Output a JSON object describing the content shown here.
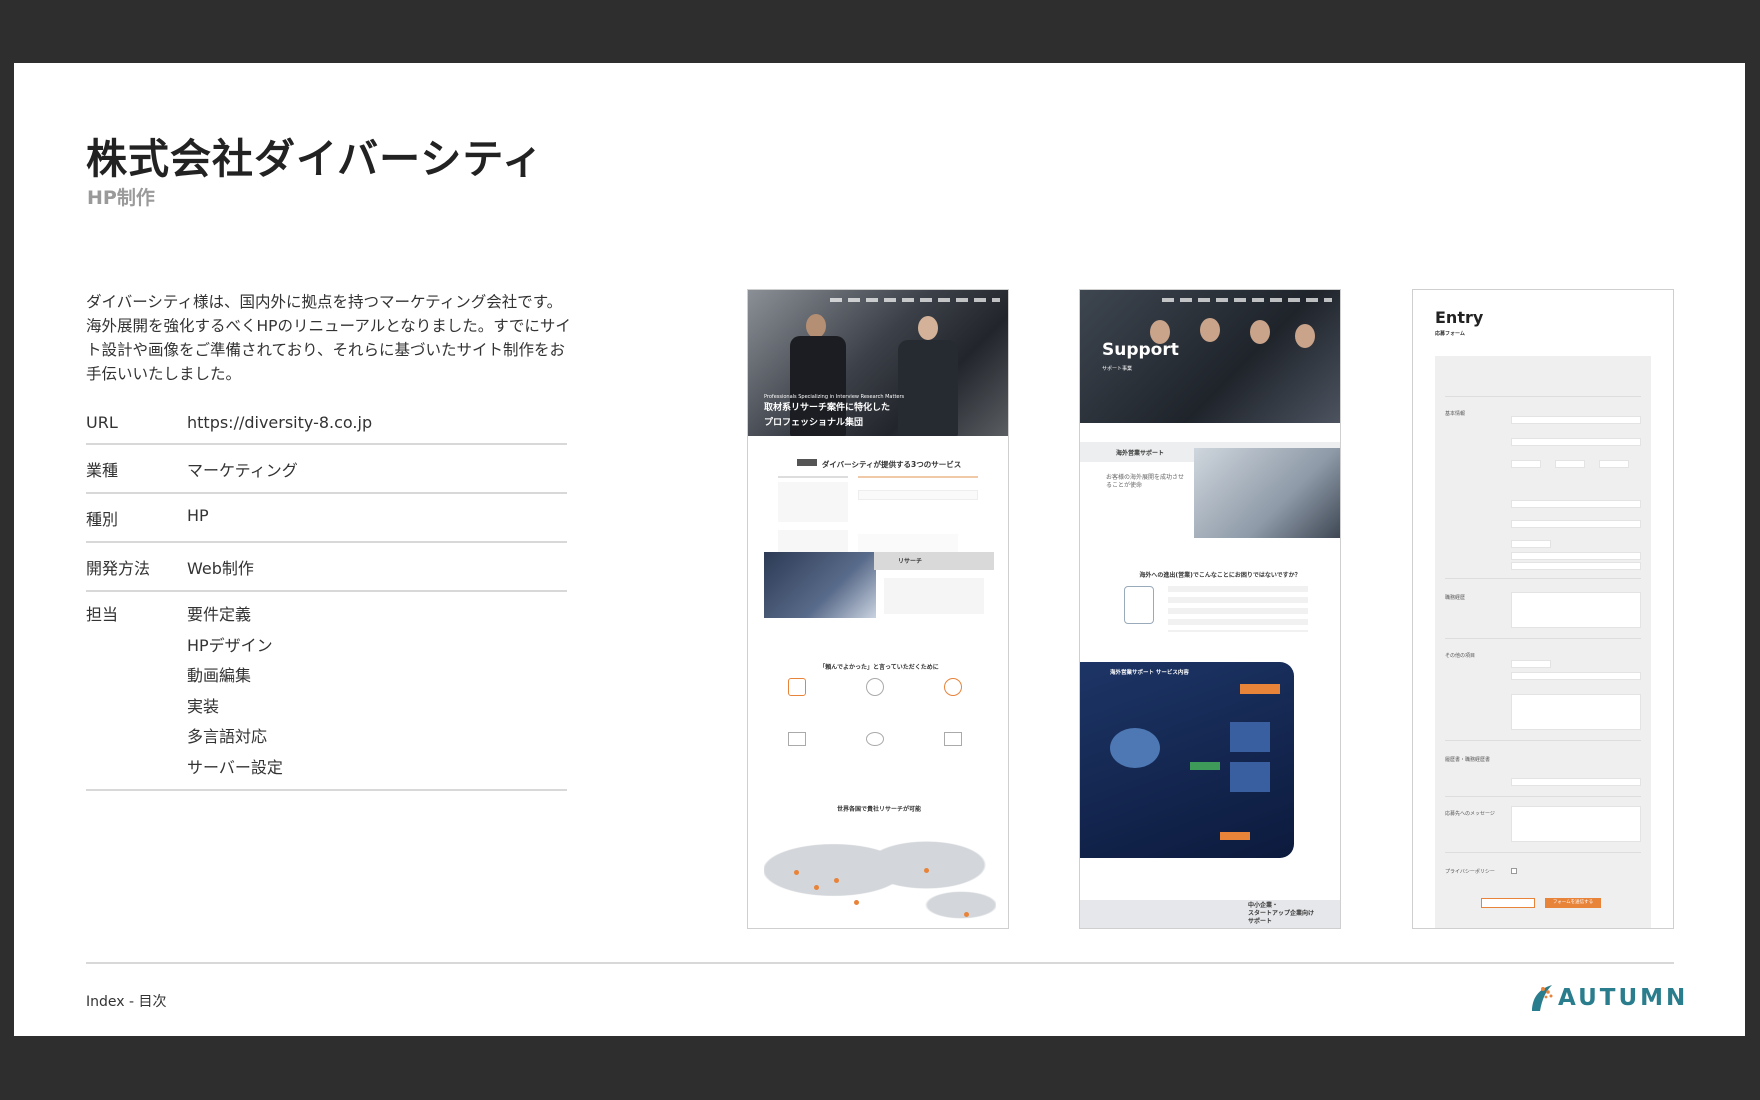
{
  "header": {
    "title": "株式会社ダイバーシティ",
    "subtitle": "HP制作"
  },
  "description": "ダイバーシティ様は、国内外に拠点を持つマーケティング会社です。海外展開を強化するべくHPのリニューアルとなりました。すでにサイト設計や画像をご準備されており、それらに基づいたサイト制作をお手伝いいたしました。",
  "info": {
    "url_label": "URL",
    "url_value": "https://diversity-8.co.jp",
    "industry_label": "業種",
    "industry_value": "マーケティング",
    "type_label": "種別",
    "type_value": "HP",
    "method_label": "開発方法",
    "method_value": "Web制作",
    "role_label": "担当",
    "roles": [
      "要件定義",
      "HPデザイン",
      "動画編集",
      "実装",
      "多言語対応",
      "サーバー設定"
    ]
  },
  "shot1": {
    "hero_small": "Professionals Specializing in Interview Research Matters",
    "hero_line1": "取材系リサーチ案件に特化した",
    "hero_line2": "プロフェッショナル集団",
    "services_heading": "ダイバーシティが提供する3つのサービス",
    "research_label": "リサーチ",
    "voice_heading": "「頼んでよかった」と言っていただくために",
    "world_heading": "世界各国で貴社リサーチが可能"
  },
  "shot2": {
    "hero_title": "Support",
    "hero_sub": "サポート事業",
    "section_label": "海外営業サポート",
    "section_text": "お客様の海外展開を成功させることが使命",
    "question": "海外への進出(営業)でこんなことにお困りではないですか？",
    "diagram_title": "海外営業サポート サービス内容",
    "sme_line1": "中小企業・",
    "sme_line2": "スタートアップ企業向け",
    "sme_line3": "サポート"
  },
  "shot3": {
    "title": "Entry",
    "sub": "応募フォーム",
    "basic_info": "基本情報",
    "career": "職務経歴",
    "other": "その他の項目",
    "resume": "履歴書・職務経歴書",
    "message": "応募先へのメッセージ",
    "privacy": "プライバシーポリシー",
    "confirm_btn": "フォームを送信する"
  },
  "footer": {
    "index": "Index  -  目次",
    "logo": "AUTUMN"
  },
  "colors": {
    "accent": "#e8833a",
    "logo": "#2a7d8c",
    "frame": "#2e2e2e"
  }
}
